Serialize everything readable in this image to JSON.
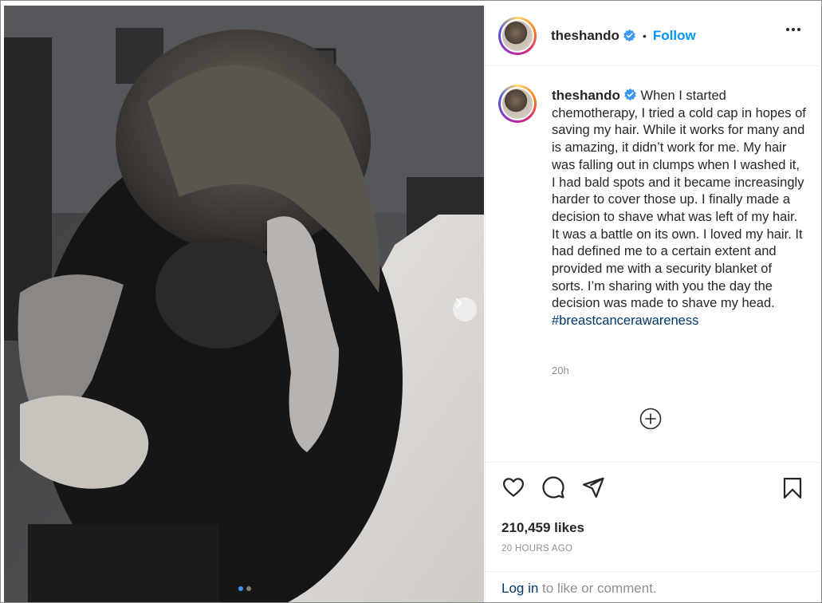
{
  "post": {
    "author": "theshando",
    "follow_label": "Follow",
    "separator": "•",
    "caption_text": "When I started chemotherapy, I tried a cold cap in hopes of saving my hair. While it works for many and is amazing, it didn’t work for me. My hair was falling out in clumps when I washed it, I had bald spots and it became increasingly harder to cover those up. I finally made a decision to shave what was left of my hair. It was a battle on its own. I loved my hair. It had defined me to a certain extent and provided me with a security blanket of sorts. I’m sharing with you the day the decision was made to shave my head.",
    "hashtag": "#breastcancerawareness",
    "relative_time": "20h",
    "likes": "210,459 likes",
    "posted_ago": "20 HOURS AGO",
    "login_link": "Log in",
    "login_suffix": " to like or comment."
  },
  "icons": {
    "verified": "verified-badge-icon",
    "more": "more-options-icon",
    "next": "chevron-right-icon",
    "load_more": "plus-circle-icon",
    "like": "heart-icon",
    "comment": "comment-icon",
    "share": "paper-plane-icon",
    "save": "bookmark-icon"
  },
  "colors": {
    "link_blue": "#0095f6",
    "hashtag": "#00376b",
    "muted": "#8e8e8e",
    "text": "#262626"
  }
}
